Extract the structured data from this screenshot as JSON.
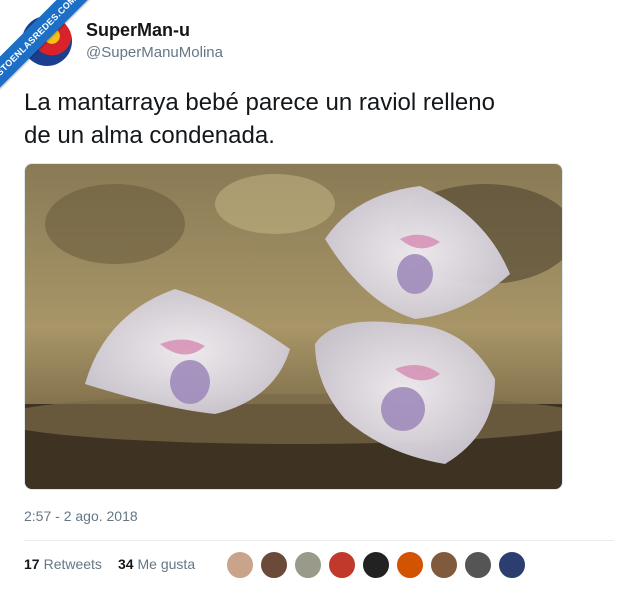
{
  "watermark": "VISTOENLASREDES.COM",
  "user": {
    "name": "SuperMan-u",
    "handle": "@SuperManuMolina"
  },
  "tweet": {
    "text_line1": "La mantarraya bebé parece un raviol relleno",
    "text_line2": "de un alma condenada."
  },
  "meta": {
    "timestamp": "2:57 - 2 ago. 2018"
  },
  "stats": {
    "retweets_count": "17",
    "retweets_label": "Retweets",
    "likes_count": "34",
    "likes_label": "Me gusta"
  },
  "likers": [
    {
      "color": "#c9a48a"
    },
    {
      "color": "#6b4a3a"
    },
    {
      "color": "#9a9a8a"
    },
    {
      "color": "#c0392b"
    },
    {
      "color": "#222222"
    },
    {
      "color": "#d35400"
    },
    {
      "color": "#7f5a3c"
    },
    {
      "color": "#555555"
    },
    {
      "color": "#2c3e70"
    }
  ]
}
